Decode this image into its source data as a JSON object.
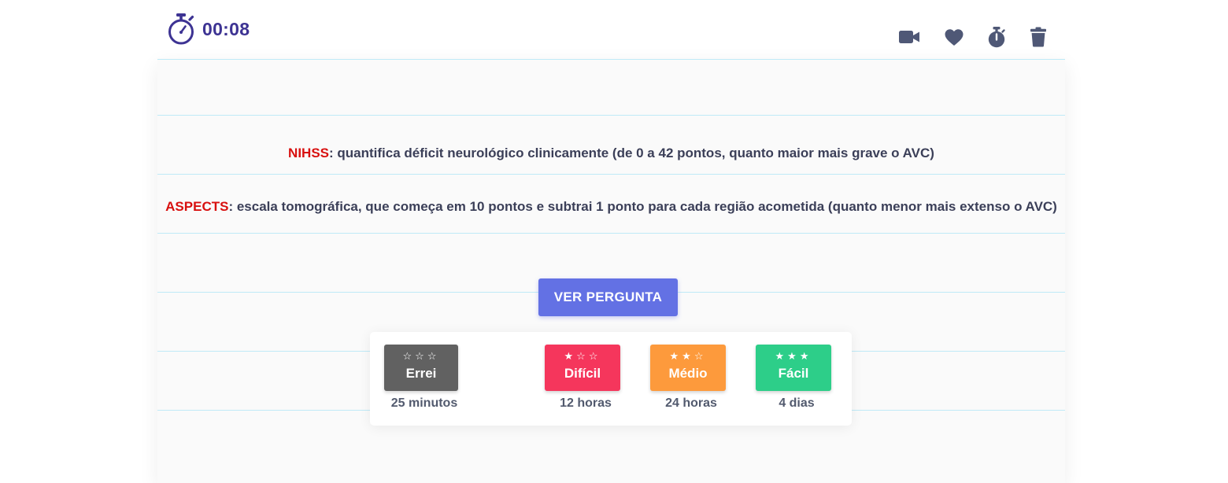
{
  "timer": {
    "time": "00:08",
    "icon": "stopwatch-icon"
  },
  "toolbar": {
    "icons": [
      "video-camera-icon",
      "heart-icon",
      "stopwatch-icon",
      "trash-icon"
    ],
    "icon_color": "#4f5876"
  },
  "card": {
    "lines": [
      {
        "term": "NIHSS",
        "text": ": quantifica déficit neurológico clinicamente (de 0 a 42 pontos, quanto maior mais grave o AVC)"
      },
      {
        "term": "ASPECTS",
        "text": ": escala tomográfica, que começa em 10 pontos e subtrai 1 ponto para cada região acometida (quanto menor mais extenso o AVC)"
      }
    ],
    "term_color": "#d8100f"
  },
  "actions": {
    "show_question_label": "VER PERGUNTA",
    "grades": [
      {
        "label": "Errei",
        "stars": "☆☆☆",
        "time": "25 minutos",
        "color": "#616161"
      },
      {
        "label": "Difícil",
        "stars": "★☆☆",
        "time": "12 horas",
        "color": "#f5365c"
      },
      {
        "label": "Médio",
        "stars": "★★☆",
        "time": "24 horas",
        "color": "#fd9a3c"
      },
      {
        "label": "Fácil",
        "stars": "★★★",
        "time": "4 dias",
        "color": "#2dce89"
      }
    ]
  }
}
